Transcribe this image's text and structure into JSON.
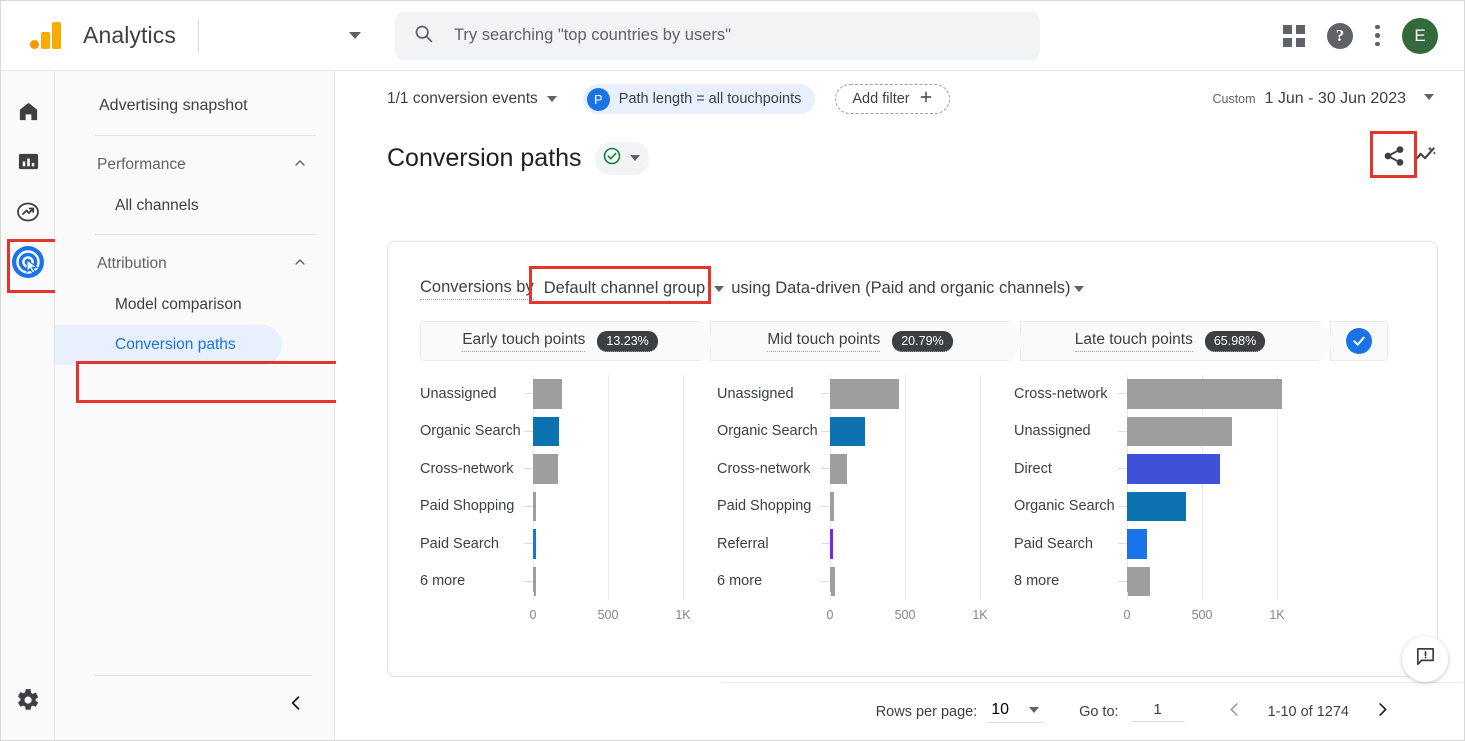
{
  "topbar": {
    "brand": "Analytics",
    "search_placeholder": "Try searching \"top countries by users\"",
    "avatar_initial": "E",
    "help_glyph": "?"
  },
  "rail": {
    "items": [
      {
        "name": "home",
        "label": "Home"
      },
      {
        "name": "reports",
        "label": "Reports"
      },
      {
        "name": "explore",
        "label": "Explore"
      },
      {
        "name": "advertising",
        "label": "Advertising"
      }
    ],
    "settings_label": "Admin"
  },
  "nav": {
    "snapshot": "Advertising snapshot",
    "performance_group": "Performance",
    "all_channels": "All channels",
    "attribution_group": "Attribution",
    "model_comparison": "Model comparison",
    "conversion_paths": "Conversion paths"
  },
  "filters": {
    "conversion_events": "1/1 conversion events",
    "path_badge": "P",
    "path_length": "Path length = all touchpoints",
    "add_filter": "Add filter",
    "add_filter_plus": "+"
  },
  "daterange": {
    "prefix": "Custom",
    "value": "1 Jun - 30 Jun 2023"
  },
  "page": {
    "title": "Conversion paths"
  },
  "card": {
    "by_label": "Conversions by",
    "dimension": "Default channel group",
    "model_text": "using Data-driven (Paid and organic channels)"
  },
  "segments": [
    {
      "label": "Early touch points",
      "pct": "13.23%"
    },
    {
      "label": "Mid touch points",
      "pct": "20.79%"
    },
    {
      "label": "Late touch points",
      "pct": "65.98%"
    }
  ],
  "pagination": {
    "rows_per_page_label": "Rows per page:",
    "rows_per_page_value": "10",
    "goto_label": "Go to:",
    "goto_value": "1",
    "range": "1-10 of 1274"
  },
  "colors": {
    "gray": "#9e9e9e",
    "teal": "#0c72b0",
    "blue_bright": "#1a73e8",
    "blue_royal": "#3f51d8",
    "purple": "#7826e8",
    "accent": "#1a73e8",
    "highlight": "#e4352c"
  },
  "chart_data": [
    {
      "type": "bar",
      "title": "Early touch points",
      "orientation": "horizontal",
      "xlabel": "",
      "ylabel": "",
      "xlim": [
        0,
        1200
      ],
      "ticks": [
        "0",
        "500",
        "1K"
      ],
      "tick_values": [
        0,
        500,
        1000
      ],
      "grid": true,
      "categories": [
        "Unassigned",
        "Organic Search",
        "Cross-network",
        "Paid Shopping",
        "Paid Search",
        "6 more"
      ],
      "values": [
        190,
        175,
        165,
        12,
        8,
        22
      ],
      "bar_colors": [
        "#9e9e9e",
        "#0c72b0",
        "#9e9e9e",
        "#9e9e9e",
        "#1a73e8",
        "#9e9e9e"
      ]
    },
    {
      "type": "bar",
      "title": "Mid touch points",
      "orientation": "horizontal",
      "xlabel": "",
      "ylabel": "",
      "xlim": [
        0,
        1200
      ],
      "ticks": [
        "0",
        "500",
        "1K"
      ],
      "tick_values": [
        0,
        500,
        1000
      ],
      "grid": true,
      "categories": [
        "Unassigned",
        "Organic Search",
        "Cross-network",
        "Paid Shopping",
        "Referral",
        "6 more"
      ],
      "values": [
        460,
        235,
        115,
        25,
        12,
        35
      ],
      "bar_colors": [
        "#9e9e9e",
        "#0c72b0",
        "#9e9e9e",
        "#9e9e9e",
        "#7826e8",
        "#9e9e9e"
      ]
    },
    {
      "type": "bar",
      "title": "Late touch points",
      "orientation": "horizontal",
      "xlabel": "",
      "ylabel": "",
      "xlim": [
        0,
        1200
      ],
      "ticks": [
        "0",
        "500",
        "1K"
      ],
      "tick_values": [
        0,
        500,
        1000
      ],
      "grid": true,
      "categories": [
        "Cross-network",
        "Unassigned",
        "Direct",
        "Organic Search",
        "Paid Search",
        "8 more"
      ],
      "values": [
        1030,
        700,
        620,
        390,
        135,
        155
      ],
      "bar_colors": [
        "#9e9e9e",
        "#9e9e9e",
        "#3f51d8",
        "#0c72b0",
        "#1a73e8",
        "#9e9e9e"
      ]
    }
  ]
}
